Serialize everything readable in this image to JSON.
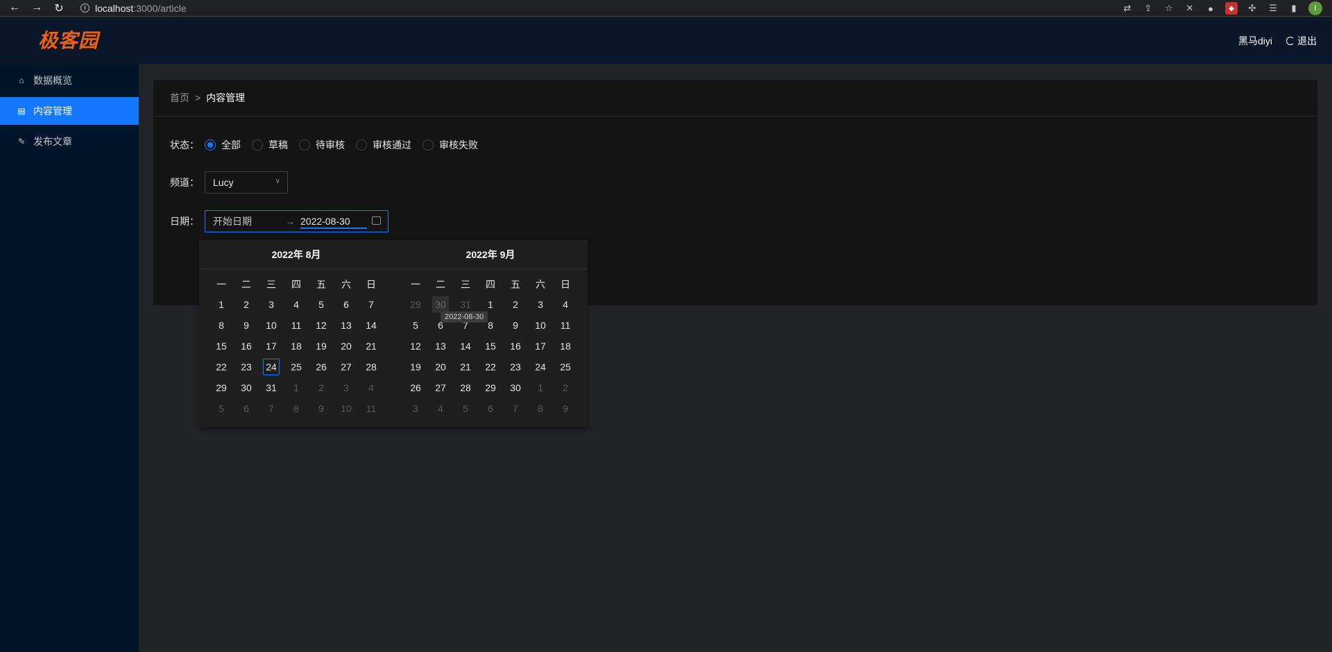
{
  "browser": {
    "url_host": "localhost",
    "url_path": ":3000/article"
  },
  "header": {
    "logo": "极客园",
    "username": "黑马diyi",
    "logout": "退出"
  },
  "sidebar": {
    "items": [
      {
        "label": "数据概览",
        "icon": "home-icon"
      },
      {
        "label": "内容管理",
        "icon": "document-icon"
      },
      {
        "label": "发布文章",
        "icon": "edit-icon"
      }
    ]
  },
  "breadcrumb": {
    "home": "首页",
    "separator": ">",
    "current": "内容管理"
  },
  "filter": {
    "status_label": "状态",
    "status_options": [
      "全部",
      "草稿",
      "待审核",
      "审核通过",
      "审核失败"
    ],
    "status_selected": "全部",
    "channel_label": "频道",
    "channel_value": "Lucy",
    "date_label": "日期",
    "date_start_placeholder": "开始日期",
    "date_end_value": "2022-08-30"
  },
  "calendar": {
    "left_title": "2022年  8月",
    "right_title": "2022年  9月",
    "weekdays": [
      "一",
      "二",
      "三",
      "四",
      "五",
      "六",
      "日"
    ],
    "left_days": [
      "1",
      "2",
      "3",
      "4",
      "5",
      "6",
      "7",
      "8",
      "9",
      "10",
      "11",
      "12",
      "13",
      "14",
      "15",
      "16",
      "17",
      "18",
      "19",
      "20",
      "21",
      "22",
      "23",
      "24",
      "25",
      "26",
      "27",
      "28",
      "29",
      "30",
      "31",
      "1",
      "2",
      "3",
      "4",
      "5",
      "6",
      "7",
      "8",
      "9",
      "10",
      "11"
    ],
    "right_days": [
      "29",
      "30",
      "31",
      "1",
      "2",
      "3",
      "4",
      "5",
      "6",
      "7",
      "8",
      "9",
      "10",
      "11",
      "12",
      "13",
      "14",
      "15",
      "16",
      "17",
      "18",
      "19",
      "20",
      "21",
      "22",
      "23",
      "24",
      "25",
      "26",
      "27",
      "28",
      "29",
      "30",
      "1",
      "2",
      "3",
      "4",
      "5",
      "6",
      "7",
      "8",
      "9"
    ],
    "tooltip": "2022-08-30"
  },
  "colors": {
    "accent": "#1677ff",
    "logo": "#f0600e",
    "sidebar_bg": "#001529"
  }
}
